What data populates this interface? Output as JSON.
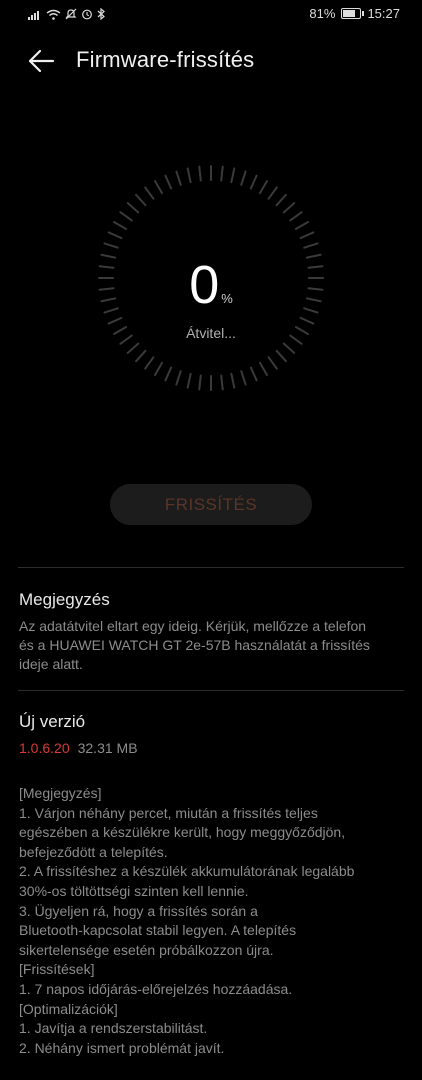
{
  "status_bar": {
    "battery_percent": "81%",
    "time": "15:27",
    "battery_level": 0.81,
    "icons": [
      "signal-icon",
      "wifi-icon",
      "silent-icon",
      "alarm-icon",
      "bluetooth-icon"
    ]
  },
  "header": {
    "title": "Firmware-frissítés"
  },
  "progress": {
    "value": "0",
    "unit": "%",
    "status": "Átvitel...",
    "fraction": 0
  },
  "actions": {
    "update_label": "FRISSÍTÉS"
  },
  "note": {
    "title": "Megjegyzés",
    "lines": [
      "Az adatátvitel eltart egy ideig. Kérjük, mellőzze a telefon",
      "és a HUAWEI WATCH GT 2e-57B használatát a frissítés",
      "ideje alatt."
    ]
  },
  "new_version": {
    "title": "Új verzió",
    "version": "1.0.6.20",
    "size": "32.31 MB",
    "notes": [
      "[Megjegyzés]",
      "1. Várjon néhány percet, miután a frissítés teljes",
      "egészében a készülékre került, hogy meggyőződjön,",
      "befejeződött a telepítés.",
      "2. A frissítéshez a készülék akkumulátorának legalább",
      "30%-os töltöttségi szinten kell lennie.",
      "3. Ügyeljen rá, hogy a frissítés során a",
      "Bluetooth-kapcsolat stabil legyen. A telepítés",
      "sikertelensége esetén próbálkozzon újra.",
      "[Frissítések]",
      "1. 7 napos időjárás-előrejelzés hozzáadása.",
      "[Optimalizációk]",
      "1. Javítja a rendszerstabilitást.",
      "2. Néhány ismert problémát javít."
    ]
  },
  "colors": {
    "background": "#000000",
    "accent": "#d63b36",
    "button_bg": "#1c1c1c",
    "button_text": "#5a3528",
    "muted_text": "#8c8c8c"
  }
}
